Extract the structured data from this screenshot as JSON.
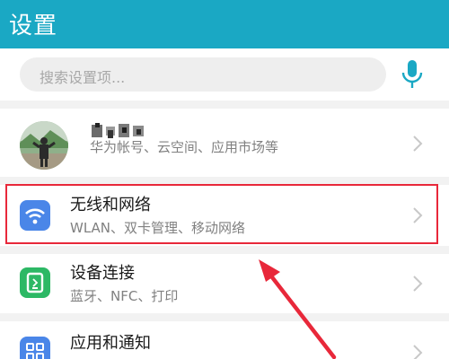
{
  "header": {
    "title": "设置"
  },
  "search": {
    "placeholder": "搜索设置项..."
  },
  "account": {
    "name": "",
    "subtitle": "华为帐号、云空间、应用市场等"
  },
  "items": [
    {
      "title": "无线和网络",
      "subtitle": "WLAN、双卡管理、移动网络",
      "icon": "wifi-icon",
      "icon_color": "#4a86e8"
    },
    {
      "title": "设备连接",
      "subtitle": "蓝牙、NFC、打印",
      "icon": "device-connection-icon",
      "icon_color": "#2db865"
    },
    {
      "title": "应用和通知",
      "subtitle": "",
      "icon": "apps-grid-icon",
      "icon_color": "#4a86e8"
    }
  ],
  "colors": {
    "header": "#1aa8c4",
    "accent": "#1aa8c4",
    "highlight": "#e8283a"
  }
}
